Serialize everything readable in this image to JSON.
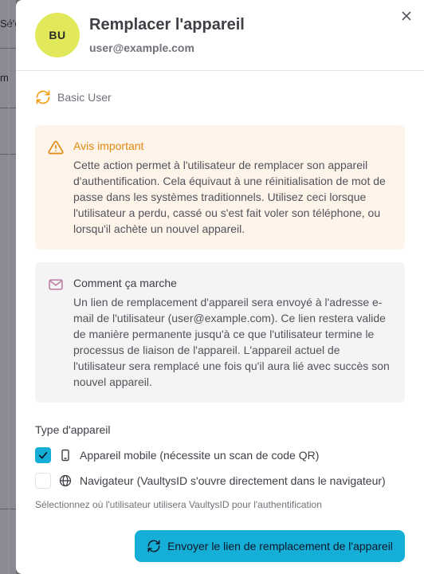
{
  "background": {
    "fragment_1": "Sé'e",
    "fragment_2": "m"
  },
  "modal": {
    "avatar_initials": "BU",
    "title": "Remplacer l'appareil",
    "email": "user@example.com",
    "role_label": "Basic User",
    "warning": {
      "title": "Avis important",
      "body": "Cette action permet à l'utilisateur de remplacer son appareil d'authentification. Cela équivaut à une réinitialisation de mot de passe dans les systèmes traditionnels. Utilisez ceci lorsque l'utilisateur a perdu, cassé ou s'est fait voler son téléphone, ou lorsqu'il achète un nouvel appareil."
    },
    "info": {
      "title": "Comment ça marche",
      "body": "Un lien de remplacement d'appareil sera envoyé à l'adresse e-mail de l'utilisateur (user@example.com). Ce lien restera valide de manière permanente jusqu'à ce que l'utilisateur termine le processus de liaison de l'appareil. L'appareil actuel de l'utilisateur sera remplacé une fois qu'il aura lié avec succès son nouvel appareil."
    },
    "device_type": {
      "label": "Type d'appareil",
      "options": [
        {
          "label": "Appareil mobile (nécessite un scan de code QR)",
          "checked": true,
          "icon": "smartphone-icon"
        },
        {
          "label": "Navigateur (VaultysID s'ouvre directement dans le navigateur)",
          "checked": false,
          "icon": "globe-icon"
        }
      ],
      "helper": "Sélectionnez où l'utilisateur utilisera VaultysID pour l'authentification"
    },
    "send_button": "Envoyer le lien de remplacement de l'appareil"
  },
  "colors": {
    "accent": "#15aed6",
    "avatar": "#e1e85a",
    "warning": "#e0890f",
    "warning_bg": "#fef4ea"
  }
}
